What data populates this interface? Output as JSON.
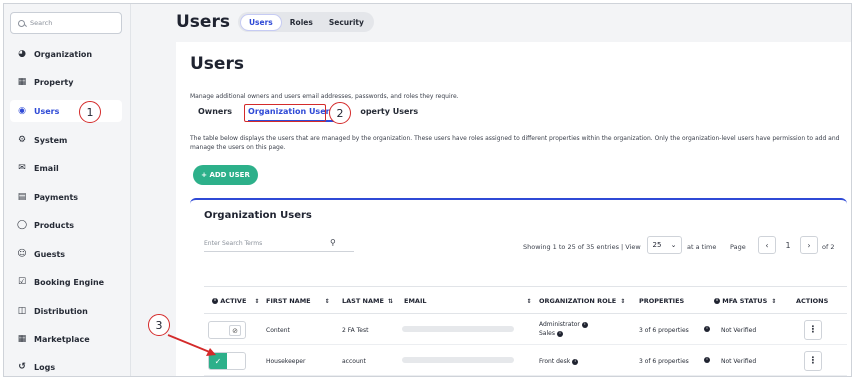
{
  "sidebar": {
    "search_placeholder": "Search",
    "items": [
      {
        "label": "Organization",
        "icon": "globe-icon"
      },
      {
        "label": "Property",
        "icon": "building-icon"
      },
      {
        "label": "Users",
        "icon": "user-icon"
      },
      {
        "label": "System",
        "icon": "gear-icon"
      },
      {
        "label": "Email",
        "icon": "mail-icon"
      },
      {
        "label": "Payments",
        "icon": "card-icon"
      },
      {
        "label": "Products",
        "icon": "cart-icon"
      },
      {
        "label": "Guests",
        "icon": "person-icon"
      },
      {
        "label": "Booking Engine",
        "icon": "calendar-check-icon"
      },
      {
        "label": "Distribution",
        "icon": "sitemap-icon"
      },
      {
        "label": "Marketplace",
        "icon": "apps-icon"
      },
      {
        "label": "Logs",
        "icon": "history-icon"
      }
    ]
  },
  "header": {
    "title": "Users",
    "pills": [
      "Users",
      "Roles",
      "Security"
    ]
  },
  "main": {
    "title": "Users",
    "description": "Manage additional owners and users email addresses, passwords, and roles they require.",
    "tabs": [
      "Owners",
      "Organization Users",
      "Property Users"
    ],
    "tab_org_visible": "Organization Users",
    "tab_property_visible": "operty Users",
    "table_description": "The table below displays the users that are managed by the organization. These users have roles assigned to different properties within the organization. Only the organization-level users have permission to add and manage the users on this page.",
    "add_user_label": "+ ADD USER"
  },
  "card": {
    "title": "Organization Users",
    "search_placeholder": "Enter Search Terms",
    "showing_text": "Showing 1 to 25 of 35 entries | View",
    "per_page": "25",
    "at_a_time": "at a time",
    "page_label": "Page",
    "page_number": "1",
    "of_pages": "of 2",
    "columns": [
      "ACTIVE",
      "FIRST NAME",
      "LAST NAME",
      "EMAIL",
      "ORGANIZATION ROLE",
      "PROPERTIES",
      "MFA STATUS",
      "ACTIONS"
    ],
    "rows": [
      {
        "active": false,
        "first_name": "Content",
        "last_name": "2 FA Test",
        "role_line1": "Administrator",
        "role_line2": "Sales",
        "properties": "3 of 6 properties",
        "mfa": "Not Verified"
      },
      {
        "active": true,
        "first_name": "Housekeeper",
        "last_name": "account",
        "role_line1": "Front desk",
        "role_line2": "",
        "properties": "3 of 6 properties",
        "mfa": "Not Verified"
      }
    ]
  },
  "annotations": [
    "1",
    "2",
    "3"
  ],
  "colors": {
    "accent": "#2f4ad6",
    "success": "#2db08a",
    "annotation": "#d42a2a"
  }
}
